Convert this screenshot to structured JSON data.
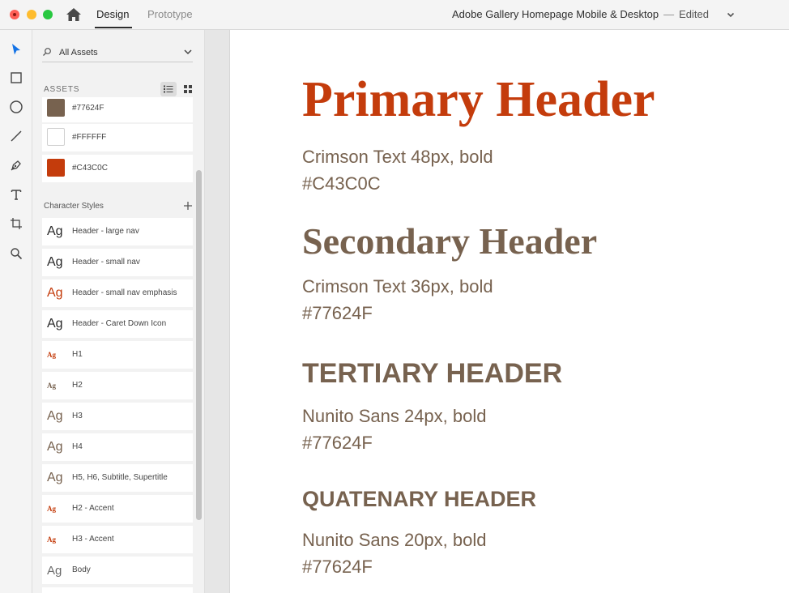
{
  "colors": {
    "accent_red": "#C43C0C",
    "brown": "#77624F",
    "white": "#FFFFFF",
    "tool_active": "#1473e6"
  },
  "titlebar": {
    "tabs": [
      {
        "label": "Design",
        "active": true
      },
      {
        "label": "Prototype",
        "active": false
      }
    ],
    "document_title": "Adobe Gallery Homepage Mobile & Desktop",
    "separator": "—",
    "status": "Edited",
    "icons": [
      "close-icon",
      "minimize-icon",
      "zoom-icon",
      "home-icon",
      "chevron-down-icon"
    ]
  },
  "tools": [
    {
      "name": "select",
      "icon": "arrow-pointer-icon",
      "active": true
    },
    {
      "name": "rectangle",
      "icon": "rectangle-icon",
      "active": false
    },
    {
      "name": "ellipse",
      "icon": "ellipse-icon",
      "active": false
    },
    {
      "name": "line",
      "icon": "line-icon",
      "active": false
    },
    {
      "name": "pen",
      "icon": "pen-icon",
      "active": false
    },
    {
      "name": "text",
      "icon": "text-icon",
      "active": false
    },
    {
      "name": "artboard",
      "icon": "artboard-icon",
      "active": false
    },
    {
      "name": "zoom",
      "icon": "zoom-icon",
      "active": false
    }
  ],
  "assets_panel": {
    "filter_label": "All Assets",
    "section_title": "ASSETS",
    "colors": [
      {
        "label": "#77624F",
        "hex": "#77624F"
      },
      {
        "label": "#FFFFFF",
        "hex": "#FFFFFF"
      },
      {
        "label": "#C43C0C",
        "hex": "#C43C0C"
      }
    ],
    "character_styles_title": "Character Styles",
    "character_styles": [
      {
        "label": "Header - large nav",
        "glyph": "Ag",
        "kind": "sans",
        "color": "#2a2a2a"
      },
      {
        "label": "Header - small nav",
        "glyph": "Ag",
        "kind": "sans",
        "color": "#2a2a2a"
      },
      {
        "label": "Header - small nav emphasis",
        "glyph": "Ag",
        "kind": "sans",
        "color": "#C43C0C"
      },
      {
        "label": "Header - Caret Down Icon",
        "glyph": "Ag",
        "kind": "sans",
        "color": "#2a2a2a"
      },
      {
        "label": "H1",
        "glyph": "Ag",
        "kind": "serif-small",
        "color": "#C43C0C"
      },
      {
        "label": "H2",
        "glyph": "Ag",
        "kind": "serif-small",
        "color": "#77624F"
      },
      {
        "label": "H3",
        "glyph": "Ag",
        "kind": "sans",
        "color": "#77624F"
      },
      {
        "label": "H4",
        "glyph": "Ag",
        "kind": "sans",
        "color": "#77624F"
      },
      {
        "label": "H5, H6, Subtitle, Supertitle",
        "glyph": "Ag",
        "kind": "sans",
        "color": "#77624F"
      },
      {
        "label": "H2 - Accent",
        "glyph": "Ag",
        "kind": "serif-small",
        "color": "#C43C0C"
      },
      {
        "label": "H3 - Accent",
        "glyph": "Ag",
        "kind": "serif-small",
        "color": "#C43C0C"
      },
      {
        "label": "Body",
        "glyph": "Ag",
        "kind": "sans-gray",
        "color": "#6b6b6b"
      }
    ]
  },
  "canvas": {
    "primary": {
      "title": "Primary Header",
      "font": "Crimson Text 48px, bold",
      "hex": "#C43C0C",
      "color": "#C43C0C"
    },
    "secondary": {
      "title": "Secondary Header",
      "font": "Crimson Text 36px, bold",
      "hex": "#77624F",
      "color": "#77624F"
    },
    "tertiary": {
      "title": "TERTIARY HEADER",
      "font": "Nunito Sans 24px, bold",
      "hex": "#77624F",
      "color": "#77624F"
    },
    "quaternary": {
      "title": "QUATENARY HEADER",
      "font": "Nunito Sans 20px, bold",
      "hex": "#77624F",
      "color": "#77624F"
    }
  }
}
